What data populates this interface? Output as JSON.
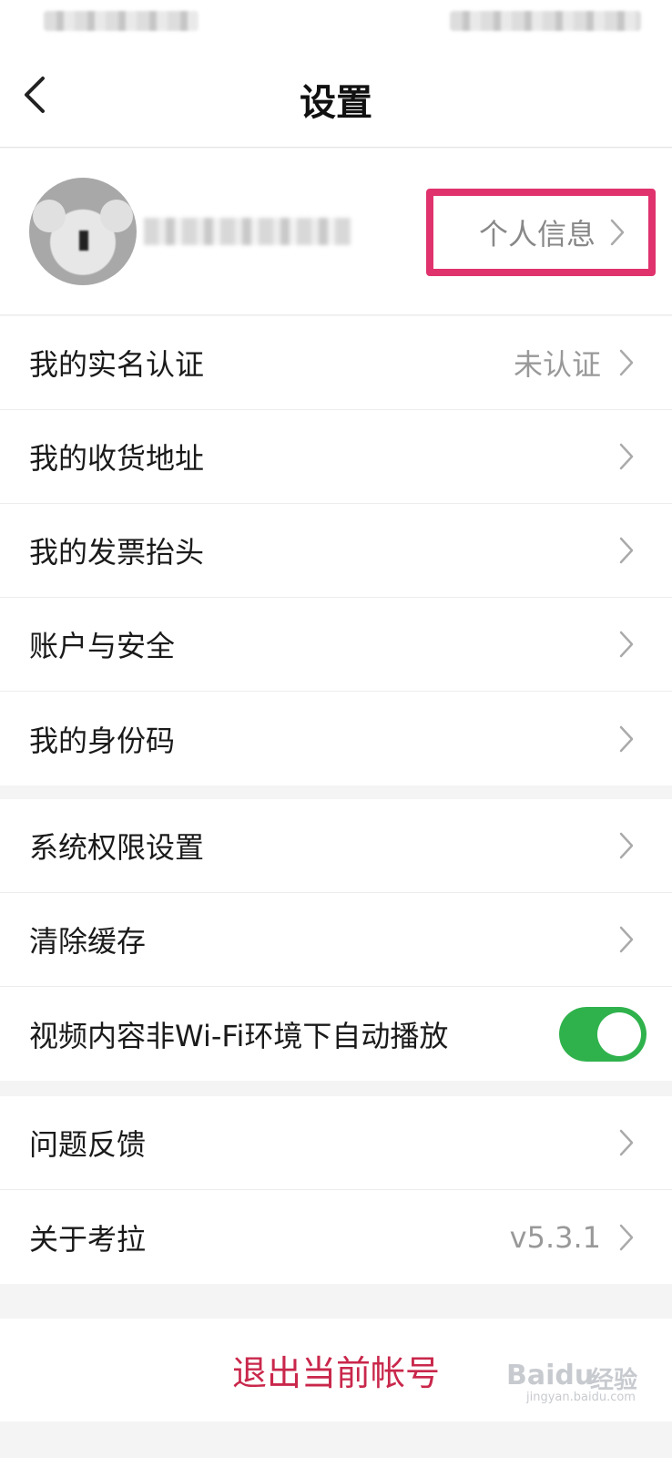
{
  "header": {
    "title": "设置"
  },
  "profile": {
    "personal_info_label": "个人信息"
  },
  "section1": {
    "items": [
      {
        "label": "我的实名认证",
        "value": "未认证"
      },
      {
        "label": "我的收货地址"
      },
      {
        "label": "我的发票抬头"
      },
      {
        "label": "账户与安全"
      },
      {
        "label": "我的身份码"
      }
    ]
  },
  "section2": {
    "items": [
      {
        "label": "系统权限设置"
      },
      {
        "label": "清除缓存"
      },
      {
        "label": "视频内容非Wi-Fi环境下自动播放",
        "toggle_on": true
      }
    ]
  },
  "section3": {
    "items": [
      {
        "label": "问题反馈"
      },
      {
        "label": "关于考拉",
        "value": "v5.3.1"
      }
    ]
  },
  "logout": {
    "label": "退出当前帐号"
  },
  "watermark": {
    "brand": "Baidu",
    "cn": "经验",
    "url": "jingyan.baidu.com"
  },
  "colors": {
    "accent": "#c9274b",
    "highlight": "#e0336e",
    "toggle": "#2fb24c"
  }
}
